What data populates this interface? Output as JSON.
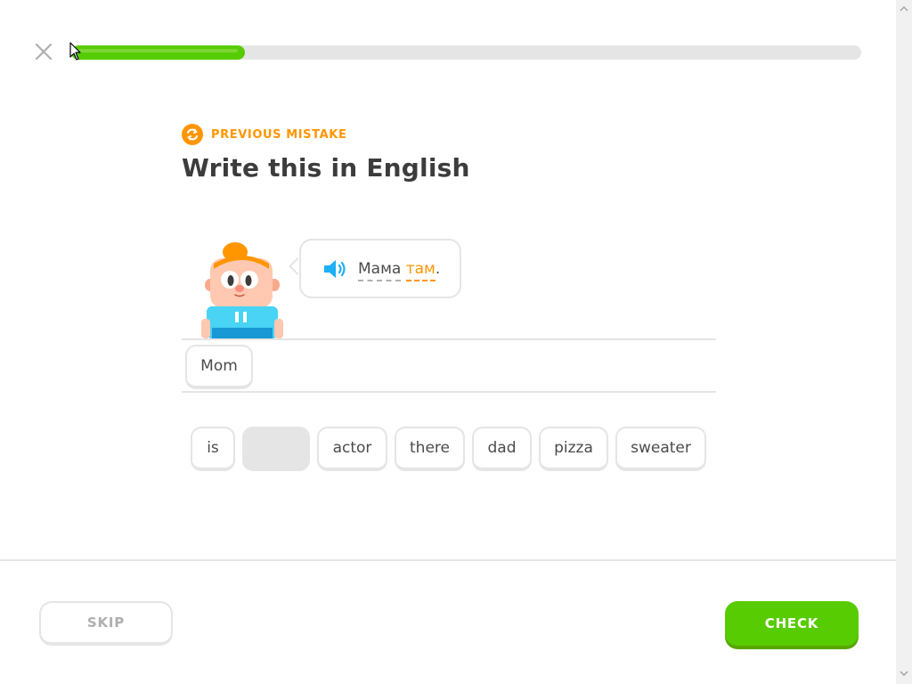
{
  "progress": {
    "value": 0.22
  },
  "header": {
    "prev_mistake_label": "PREVIOUS MISTAKE",
    "title": "Write this in English"
  },
  "prompt": {
    "words": [
      "Мама",
      "там"
    ],
    "punctuation": "."
  },
  "answer": {
    "tiles": [
      "Mom"
    ]
  },
  "word_bank": {
    "tiles": [
      "is",
      "",
      "actor",
      "there",
      "dad",
      "pizza",
      "sweater"
    ]
  },
  "footer": {
    "skip_label": "SKIP",
    "check_label": "CHECK"
  },
  "colors": {
    "accent_green": "#58cc02",
    "warning_orange": "#ff9600",
    "speaker_blue": "#1cb0f6",
    "border_gray": "#e5e5e5"
  },
  "icons": {
    "close": "close-icon",
    "prev_mistake": "refresh-icon",
    "audio": "speaker-icon"
  }
}
